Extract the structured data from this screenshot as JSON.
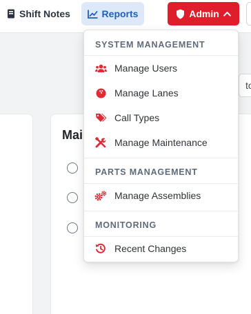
{
  "navbar": {
    "shift_notes_label": "Shift Notes",
    "reports_label": "Reports",
    "admin_label": "Admin"
  },
  "background": {
    "control_text": "to D",
    "card_title": "Mai"
  },
  "admin_menu": {
    "sections": [
      {
        "header": "SYSTEM MANAGEMENT",
        "items": [
          {
            "label": "Manage Users",
            "icon": "users-icon"
          },
          {
            "label": "Manage Lanes",
            "icon": "bowling-ball-icon"
          },
          {
            "label": "Call Types",
            "icon": "tags-icon"
          },
          {
            "label": "Manage Maintenance",
            "icon": "tools-icon"
          }
        ]
      },
      {
        "header": "PARTS MANAGEMENT",
        "items": [
          {
            "label": "Manage Assemblies",
            "icon": "cogs-icon"
          }
        ]
      },
      {
        "header": "MONITORING",
        "items": [
          {
            "label": "Recent Changes",
            "icon": "history-icon"
          }
        ]
      }
    ]
  },
  "colors": {
    "admin_red": "#e01e2b",
    "reports_blue": "#1f5fbf",
    "reports_bg": "#dde9f9",
    "icon_red": "#e02a35"
  }
}
